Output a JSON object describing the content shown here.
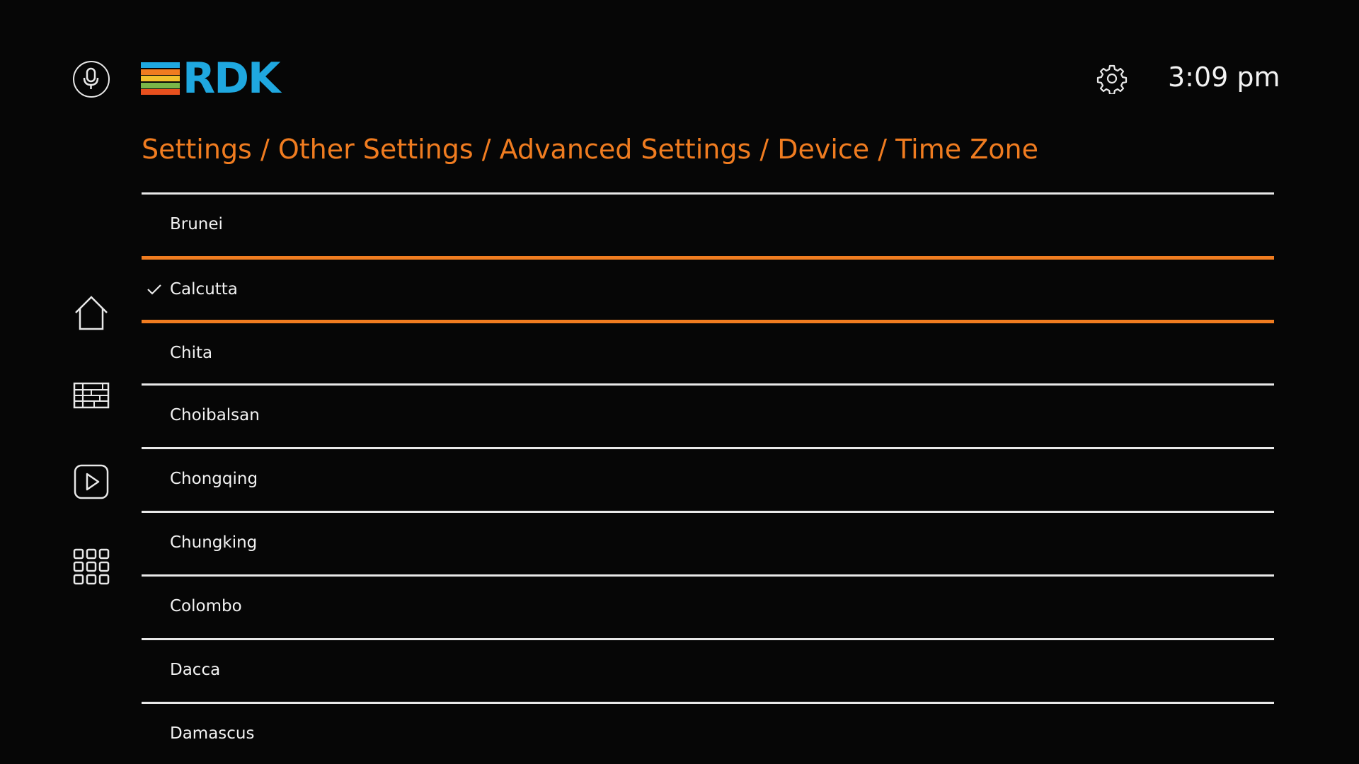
{
  "header": {
    "logo_text": "RDK",
    "logo_bar_colors": [
      "#1fa8e0",
      "#f07c20",
      "#f2c12e",
      "#7ab648",
      "#e8501e"
    ],
    "clock": "3:09 pm"
  },
  "breadcrumb": "Settings / Other Settings / Advanced Settings / Device / Time Zone",
  "accent_color": "#f07c20",
  "sidebar": {
    "icons": [
      "microphone-icon",
      "home-icon",
      "guide-grid-icon",
      "play-icon",
      "apps-grid-icon"
    ]
  },
  "timezones": [
    {
      "label": "Brunei",
      "selected": false,
      "focused": false
    },
    {
      "label": "Calcutta",
      "selected": true,
      "focused": true
    },
    {
      "label": "Chita",
      "selected": false,
      "focused": false
    },
    {
      "label": "Choibalsan",
      "selected": false,
      "focused": false
    },
    {
      "label": "Chongqing",
      "selected": false,
      "focused": false
    },
    {
      "label": "Chungking",
      "selected": false,
      "focused": false
    },
    {
      "label": "Colombo",
      "selected": false,
      "focused": false
    },
    {
      "label": "Dacca",
      "selected": false,
      "focused": false
    },
    {
      "label": "Damascus",
      "selected": false,
      "focused": false
    }
  ]
}
